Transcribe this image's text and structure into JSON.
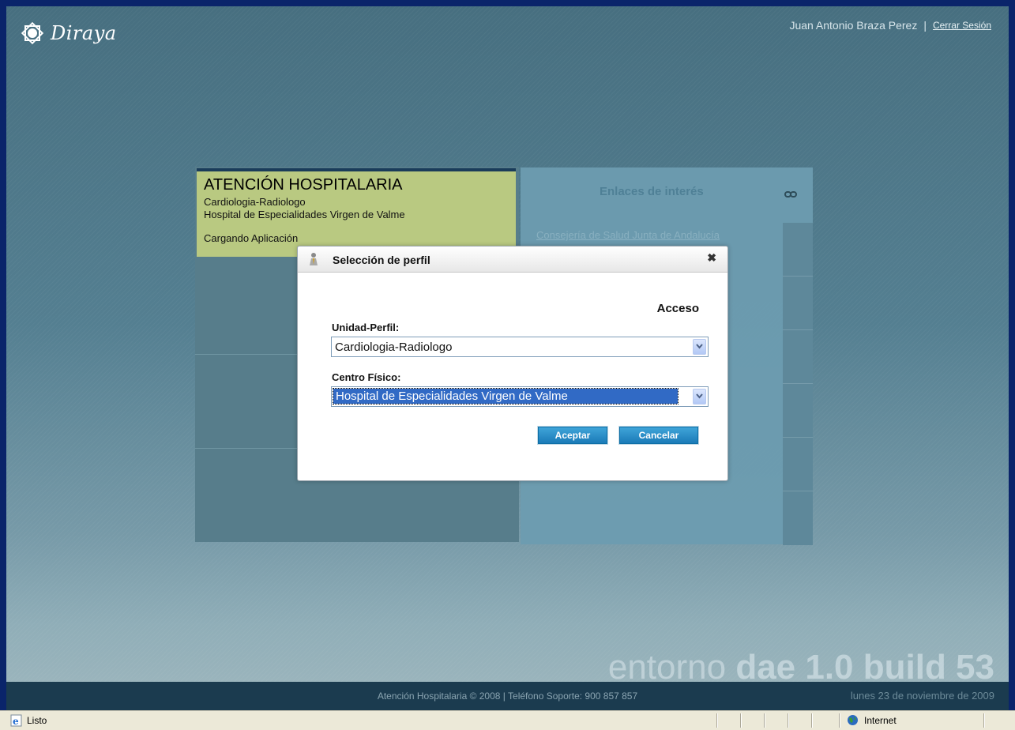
{
  "header": {
    "app_name": "Diraya",
    "user_name": "Juan Antonio Braza Perez",
    "separator": "|",
    "logout_label": "Cerrar Sesión"
  },
  "hospital_card": {
    "title": "ATENCIÓN HOSPITALARIA",
    "profile": "Cardiologia-Radiologo",
    "center": "Hospital de Especialidades Virgen de Valme",
    "loading_text": "Cargando Aplicación"
  },
  "links_panel": {
    "title": "Enlaces de interés",
    "items": [
      {
        "label": "Consejería de Salud Junta de Andalucía"
      }
    ]
  },
  "dialog": {
    "title": "Selección de perfil",
    "close_symbol": "✖",
    "heading": "Acceso",
    "unidad_label": "Unidad-Perfil:",
    "unidad_value": "Cardiologia-Radiologo",
    "centro_label": "Centro Físico:",
    "centro_value": "Hospital de Especialidades Virgen de Valme",
    "accept_label": "Aceptar",
    "cancel_label": "Cancelar"
  },
  "version": {
    "prefix": "entorno",
    "name": "dae 1.0 build 53"
  },
  "footer": {
    "copyright": "Atención Hospitalaria © 2008 | Teléfono Soporte: 900 857 857",
    "date": "lunes 23 de noviembre de 2009"
  },
  "statusbar": {
    "status": "Listo",
    "zone": "Internet"
  },
  "colors": {
    "card_bg": "#b9c981",
    "footer_bg": "#1b3b4f",
    "button_blue": "#1b7bb8",
    "selection_blue": "#316ac5"
  }
}
